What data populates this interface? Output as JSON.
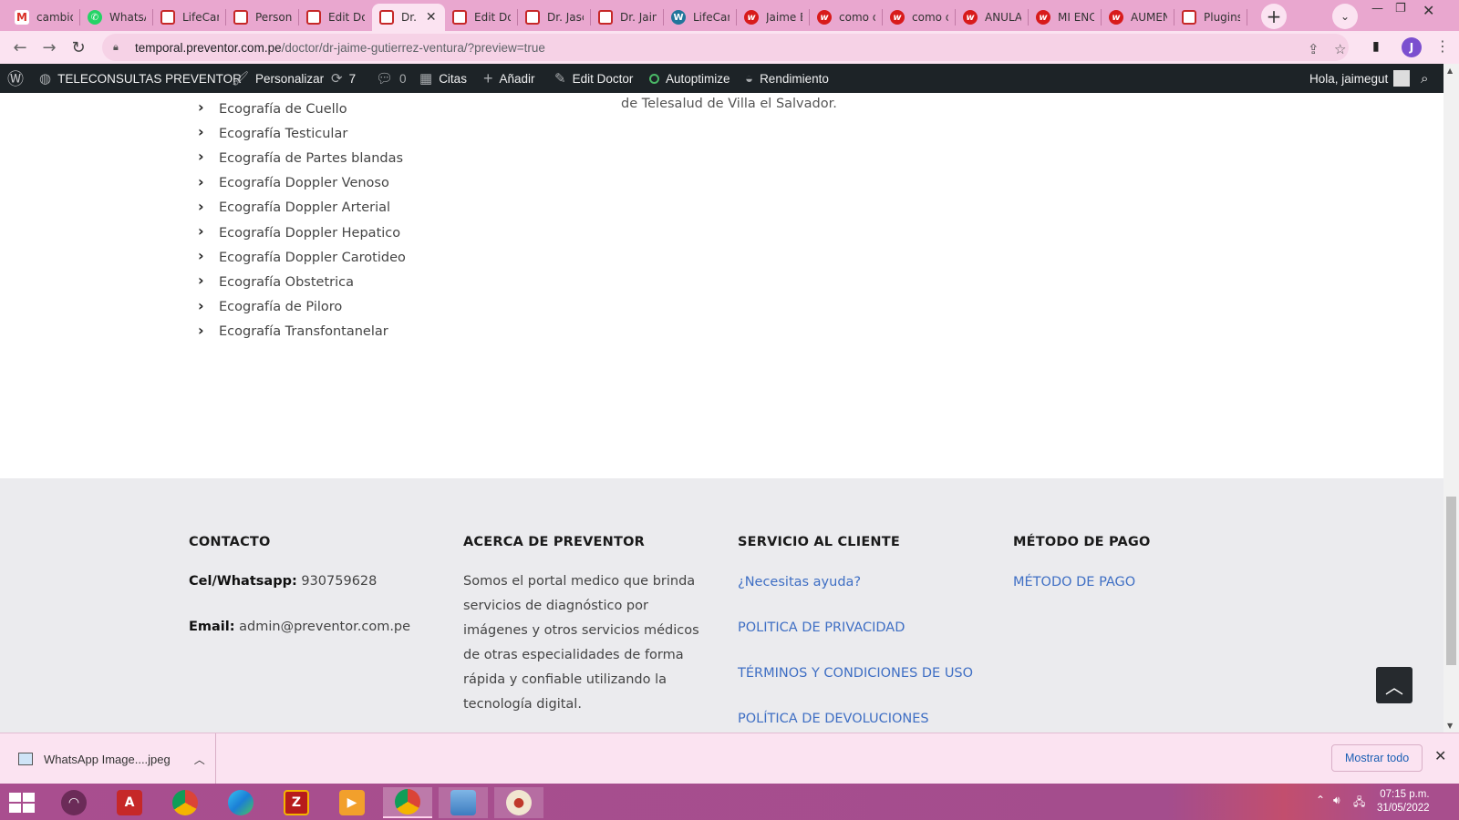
{
  "browser": {
    "tabs": [
      {
        "title": "cambio",
        "icon": "gmail-icon"
      },
      {
        "title": "WhatsA",
        "icon": "whatsapp-icon"
      },
      {
        "title": "LifeCar",
        "icon": "lifecare-icon"
      },
      {
        "title": "Person",
        "icon": "lifecare-icon"
      },
      {
        "title": "Edit Do",
        "icon": "lifecare-icon"
      },
      {
        "title": "Dr.",
        "icon": "lifecare-icon",
        "active": true
      },
      {
        "title": "Edit Do",
        "icon": "lifecare-icon"
      },
      {
        "title": "Dr. Jasc",
        "icon": "lifecare-icon"
      },
      {
        "title": "Dr. Jain",
        "icon": "lifecare-icon"
      },
      {
        "title": "LifeCar",
        "icon": "wordpress-icon"
      },
      {
        "title": "Jaime E",
        "icon": "wix-icon"
      },
      {
        "title": "como c",
        "icon": "wix-icon"
      },
      {
        "title": "como c",
        "icon": "wix-icon"
      },
      {
        "title": "ANULA",
        "icon": "wix-icon"
      },
      {
        "title": "MI ENC",
        "icon": "wix-icon"
      },
      {
        "title": "AUMEN",
        "icon": "wix-icon"
      },
      {
        "title": "Plugins",
        "icon": "lifecare-icon"
      }
    ],
    "url_host": "temporal.preventor.com.pe",
    "url_path": "/doctor/dr-jaime-gutierrez-ventura/?preview=true",
    "profile_initial": "J",
    "accent_color": "#e9a7cf"
  },
  "adminbar": {
    "site_name": "TELECONSULTAS PREVENTOR",
    "customize": "Personalizar",
    "updates_count": "7",
    "comments_count": "0",
    "citas": "Citas",
    "add_new": "Añadir",
    "edit_doctor": "Edit Doctor",
    "autoptimize": "Autoptimize",
    "performance": "Rendimiento",
    "greeting": "Hola, jaimegut"
  },
  "content": {
    "services": [
      "Ecografía de Cuello",
      "Ecografía Testicular",
      "Ecografía de Partes blandas",
      "Ecografía Doppler Venoso",
      "Ecografía Doppler Arterial",
      "Ecografía Doppler Hepatico",
      "Ecografía Doppler Carotideo",
      "Ecografía Obstetrica",
      "Ecografía de Piloro",
      "Ecografía Transfontanelar"
    ],
    "paragraph_tail": "de Telesalud de Villa el Salvador."
  },
  "footer": {
    "contact": {
      "heading": "CONTACTO",
      "phone_label": "Cel/Whatsapp:",
      "phone_value": "930759628",
      "email_label": "Email:",
      "email_value": "admin@preventor.com.pe"
    },
    "about": {
      "heading": "ACERCA DE PREVENTOR",
      "text": "Somos el portal medico que brinda servicios de diagnóstico por imágenes y otros servicios médicos de otras especialidades de forma rápida y confiable utilizando la tecnología digital."
    },
    "service": {
      "heading": "SERVICIO AL CLIENTE",
      "links": [
        "¿Necesitas ayuda?",
        "POLITICA DE PRIVACIDAD",
        "TÉRMINOS Y CONDICIONES DE USO",
        "POLÍTICA DE DEVOLUCIONES"
      ]
    },
    "payment": {
      "heading": "MÉTODO DE PAGO",
      "link": "MÉTODO DE PAGO"
    },
    "link_color": "#3f6fc4"
  },
  "downloads": {
    "file_name": "WhatsApp Image....jpeg",
    "show_all": "Mostrar todo"
  },
  "taskbar": {
    "time": "07:15 p.m.",
    "date": "31/05/2022"
  }
}
